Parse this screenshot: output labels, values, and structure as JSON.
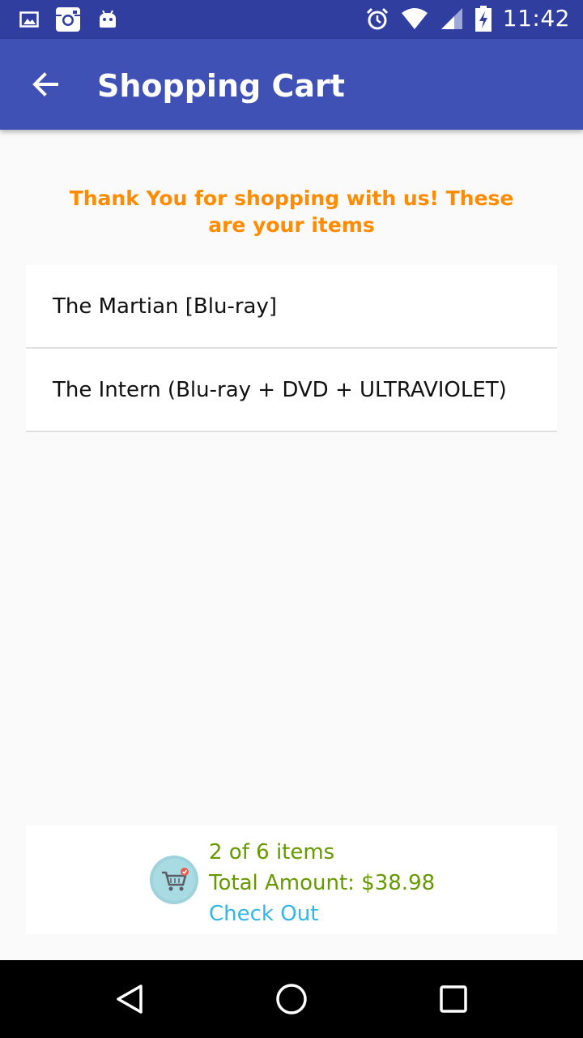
{
  "status_bar": {
    "time": "11:42",
    "left_icons": [
      "image-icon",
      "instagram-icon",
      "android-icon"
    ],
    "right_icons": [
      "alarm-icon",
      "wifi-icon",
      "signal-icon",
      "battery-charging-icon"
    ]
  },
  "app_bar": {
    "title": "Shopping Cart",
    "back_icon": "arrow-back-icon",
    "color": "#3f51b5"
  },
  "message": "Thank You for shopping with us! These are your items",
  "cart_items": [
    "The Martian [Blu-ray]",
    "The Intern (Blu-ray + DVD + ULTRAVIOLET)"
  ],
  "summary": {
    "count_text": "2 of 6 items",
    "total_text": "Total Amount: $38.98",
    "checkout_label": "Check Out",
    "icon": "cart-icon"
  },
  "nav_bar": {
    "icons": [
      "back-triangle-icon",
      "home-circle-icon",
      "recents-square-icon"
    ]
  },
  "colors": {
    "status_bar": "#303f9f",
    "message": "#ff8c00",
    "summary_text": "#669900",
    "checkout": "#33b5e5"
  }
}
